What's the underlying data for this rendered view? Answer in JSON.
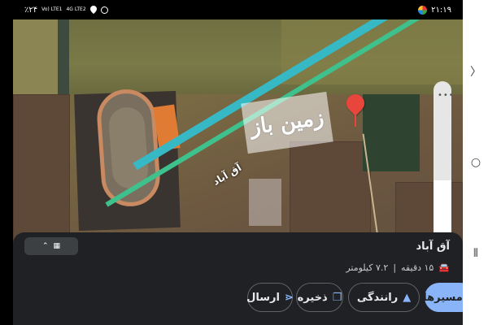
{
  "status_bar": {
    "time": "۲۱:۱۹",
    "battery": "٪۲۴",
    "net_1": "Vo) LTE1",
    "net_2": "4G LTE2",
    "icons": [
      "alarm-dot-icon",
      "location-icon",
      "app-icon"
    ]
  },
  "map": {
    "place_label": "آق آباد",
    "watermark": "زمین باز",
    "pin_color": "#e8453c",
    "road_color": "#36b9c4",
    "zoom_level_fraction": 0.45
  },
  "sheet": {
    "title": "آق آباد",
    "duration": "۱۵ دقیقه",
    "distance": "۷.۲ کیلومتر",
    "collapse_icon": "chevron-up-icon"
  },
  "actions": {
    "directions": "مسیرها",
    "drive": "رانندگی",
    "save": "ذخیره",
    "share": "ارسال"
  },
  "colors": {
    "sheet_bg": "#202124",
    "accent": "#8ab4f8"
  }
}
